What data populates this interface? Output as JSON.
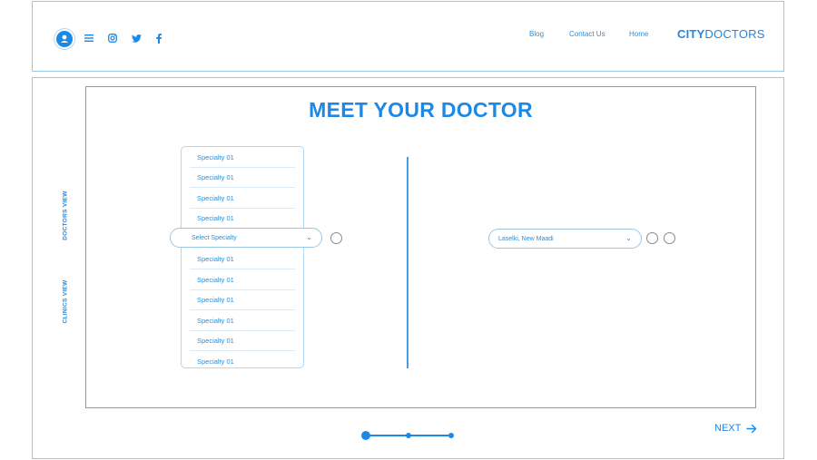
{
  "header": {
    "nav": [
      "Blog",
      "Contact Us",
      "Home"
    ],
    "brand_bold": "CITY",
    "brand_rest": "DOCTORS",
    "icons": [
      "user-icon",
      "menu-icon",
      "instagram-icon",
      "twitter-icon",
      "facebook-icon"
    ]
  },
  "main": {
    "title": "MEET YOUR DOCTOR",
    "side_tabs": [
      "DOCTORS VIEW",
      "CLINICS VIEW"
    ],
    "specialty_list": [
      "Specialty 01",
      "Specialty 01",
      "Specialty 01",
      "Specialty 01",
      "Specialty 01",
      "Specialty 01",
      "Specialty 01",
      "Specialty 01",
      "Specialty 01",
      "Specialty 01"
    ],
    "specialty_select": "Select Specialty",
    "location_select": "Laselki, New Maadi",
    "next_label": "NEXT"
  },
  "colors": {
    "accent": "#1e88e5",
    "border": "#9ac8e2"
  }
}
